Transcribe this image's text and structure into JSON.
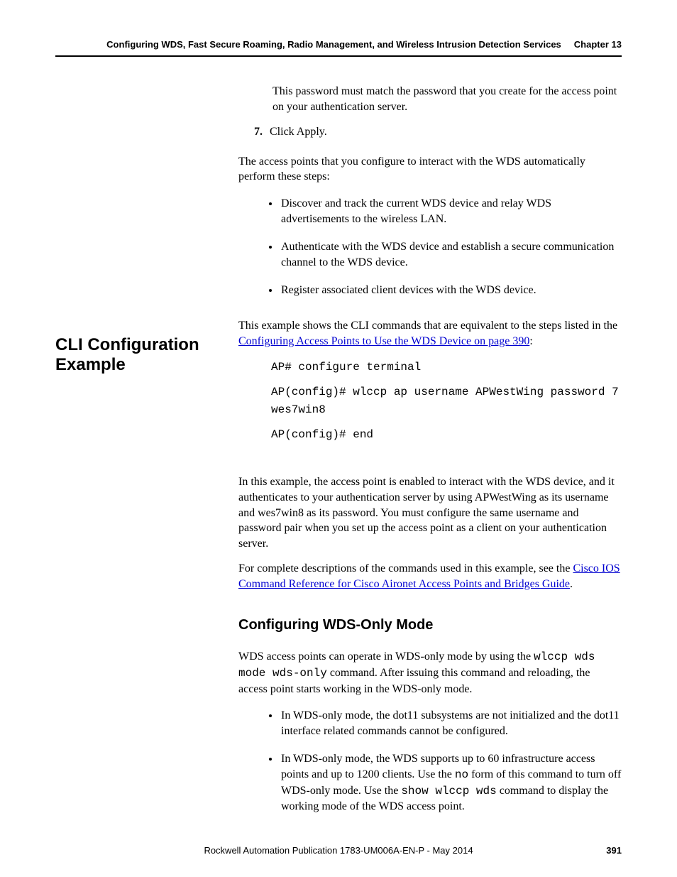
{
  "header": {
    "title": "Configuring WDS, Fast Secure Roaming, Radio Management, and Wireless Intrusion Detection Services",
    "chapter": "Chapter 13"
  },
  "top": {
    "passwordNote": "This password must match the password that you create for the access point on your authentication server.",
    "step7num": "7.",
    "step7text": "Click Apply.",
    "autoStepsIntro": "The access points that you configure to interact with the WDS automatically perform these steps:",
    "bullets": [
      "Discover and track the current WDS device and relay WDS advertisements to the wireless LAN.",
      "Authenticate with the WDS device and establish a secure communication channel to the WDS device.",
      "Register associated client devices with the WDS device."
    ]
  },
  "left": {
    "sectionTitle": "CLI Configuration Example"
  },
  "cli": {
    "intro_pre": "This example shows the CLI commands that are equivalent to the steps listed in the ",
    "intro_link": "Configuring Access Points to Use the WDS Device on page 390",
    "intro_post": ":",
    "code1": "AP# configure terminal",
    "code2": "AP(config)# wlccp ap username APWestWing password 7 wes7win8",
    "code3": "AP(config)# end",
    "explain": "In this example, the access point is enabled to interact with the WDS device, and it authenticates to your authentication server by using APWestWing as its username and wes7win8 as its password. You must configure the same username and password pair when you set up the access point as a client on your authentication server.",
    "complete_pre": "For complete descriptions of the commands used in this example, see the ",
    "complete_link": "Cisco IOS Command Reference for Cisco Aironet Access Points and Bridges Guide",
    "complete_post": "."
  },
  "wds": {
    "heading": "Configuring WDS-Only Mode",
    "p1_a": "WDS access points can operate in WDS-only mode by using the ",
    "p1_cmd": "wlccp wds mode wds-only",
    "p1_b": " command. After issuing this command and reloading, the access point starts working in the WDS-only mode.",
    "b1": "In WDS-only mode, the dot11 subsystems are not initialized and the dot11 interface related commands cannot be configured.",
    "b2_a": "In WDS-only mode, the WDS supports up to 60 infrastructure access points and up to 1200 clients. Use the ",
    "b2_no": "no",
    "b2_b": " form of this command to turn off WDS-only mode. Use the ",
    "b2_cmd": "show wlccp wds",
    "b2_c": " command to display the working mode of the WDS access point."
  },
  "footer": {
    "publication": "Rockwell Automation Publication 1783-UM006A-EN-P - May 2014",
    "page": "391"
  }
}
